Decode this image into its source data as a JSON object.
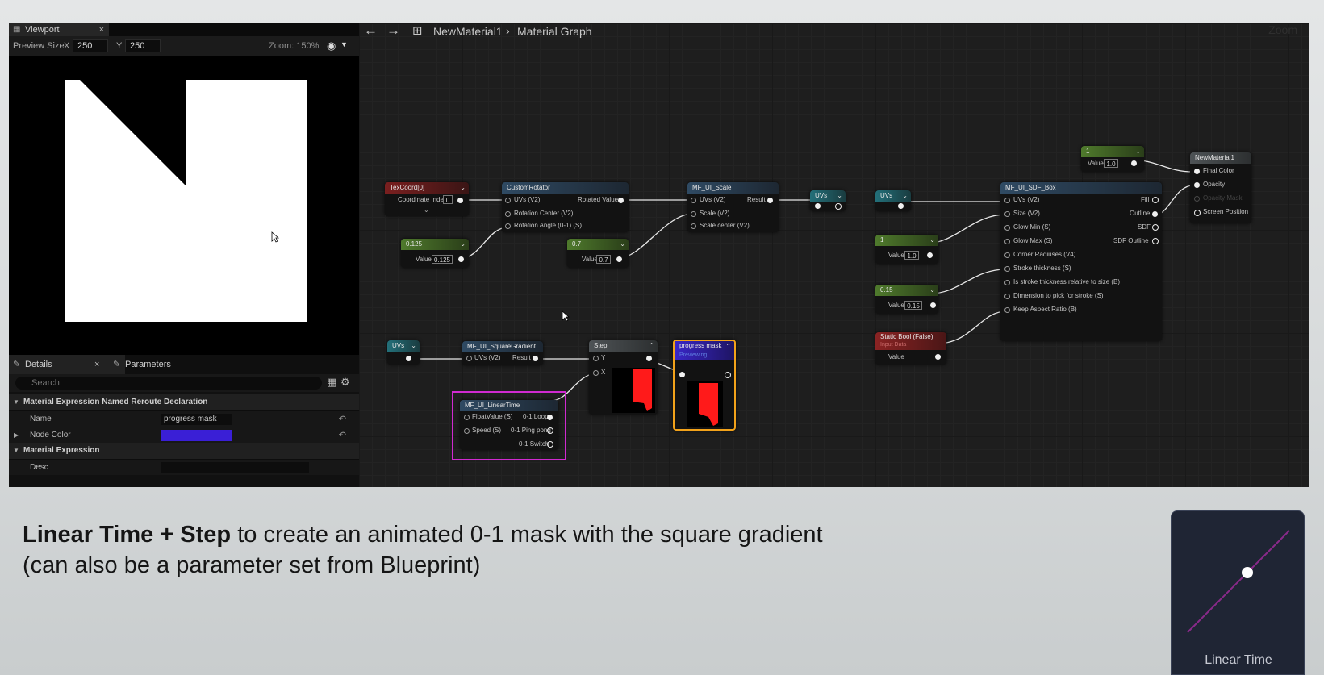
{
  "viewport": {
    "tab_label": "Viewport",
    "close": "×",
    "preview_size_label": "Preview Size",
    "x_label": "X",
    "x_value": "250",
    "y_label": "Y",
    "y_value": "250",
    "zoom_label": "Zoom: 150%"
  },
  "details": {
    "tab_label": "Details",
    "close": "×",
    "params_tab_label": "Parameters",
    "search_placeholder": "Search",
    "category_1": "Material Expression Named Reroute Declaration",
    "name_label": "Name",
    "name_value": "progress mask",
    "node_color_label": "Node Color",
    "node_color": "#3a1fd6",
    "category_2": "Material Expression",
    "desc_label": "Desc"
  },
  "graph": {
    "breadcrumb_material": "NewMaterial1",
    "breadcrumb_sep": "›",
    "breadcrumb_graph": "Material Graph",
    "zoom_label": "Zoom",
    "nodes": {
      "texcoord": {
        "title": "TexCoord[0]",
        "row": "Coordinate Index",
        "value": "0"
      },
      "customrotator": {
        "title": "CustomRotator",
        "in1": "UVs (V2)",
        "in2": "Rotation Center (V2)",
        "in3": "Rotation Angle (0-1) (S)",
        "out": "Rotated Values"
      },
      "const_0125": {
        "title": "0.125",
        "label": "Value",
        "value": "0.125"
      },
      "const_07": {
        "title": "0.7",
        "label": "Value",
        "value": "0.7"
      },
      "ui_scale": {
        "title": "MF_UI_Scale",
        "in1": "UVs (V2)",
        "in2": "Scale (V2)",
        "in3": "Scale center (V2)",
        "out": "Result"
      },
      "uvs_1": {
        "title": "UVs"
      },
      "uvs_2": {
        "title": "UVs"
      },
      "uvs_3": {
        "title": "UVs"
      },
      "const_1a": {
        "title": "1",
        "label": "Value",
        "value": "1.0"
      },
      "const_1b": {
        "title": "1",
        "label": "Value",
        "value": "1.0"
      },
      "const_015": {
        "title": "0.15",
        "label": "Value",
        "value": "0.15"
      },
      "static_bool": {
        "title": "Static Bool (False)",
        "subtitle": "Input Data",
        "label": "Value"
      },
      "sdf_box": {
        "title": "MF_UI_SDF_Box",
        "in": [
          "UVs (V2)",
          "Size (V2)",
          "Glow Min (S)",
          "Glow Max (S)",
          "Corner Radiuses (V4)",
          "Stroke thickness (S)",
          "Is stroke thickness relative to size (B)",
          "Dimension to pick for stroke (S)",
          "Keep Aspect Ratio (B)"
        ],
        "out": [
          "Fill",
          "Outline",
          "SDF",
          "SDF Outline"
        ]
      },
      "new_material": {
        "title": "NewMaterial1",
        "in": [
          "Final Color",
          "Opacity",
          "Opacity Mask",
          "Screen Position"
        ]
      },
      "square_gradient": {
        "title": "MF_UI_SquareGradient",
        "in": "UVs (V2)",
        "out": "Result"
      },
      "linear_time": {
        "title": "MF_UI_LinearTime",
        "in1": "FloatValue (S)",
        "in2": "Speed (S)",
        "out1": "0-1 Loop",
        "out2": "0-1 Ping pong",
        "out3": "0-1 Switch"
      },
      "step": {
        "title": "Step",
        "in1": "Y",
        "in2": "X"
      },
      "progress_mask": {
        "title": "progress mask",
        "subtitle": "Previewing"
      }
    }
  },
  "caption": {
    "bold": "Linear Time + Step",
    "rest1": " to create an animated 0-1 mask with the square gradient",
    "line2": "(can also be a parameter set from Blueprint)"
  },
  "thumbnail": {
    "label": "Linear Time"
  }
}
